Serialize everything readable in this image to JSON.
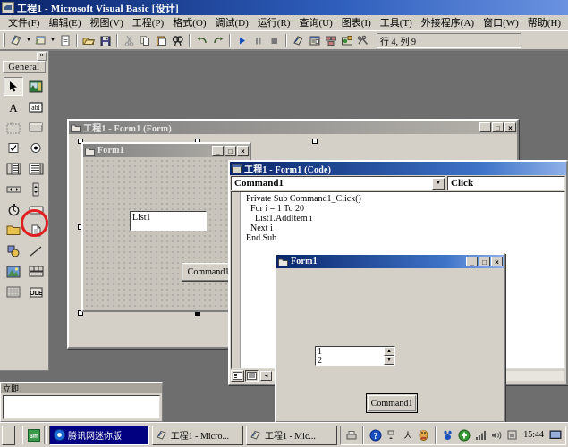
{
  "window": {
    "title": "工程1 - Microsoft Visual Basic [设计]",
    "icon": "vb-app-icon",
    "minimize": "_",
    "maximize": "□",
    "close": "×"
  },
  "menubar": {
    "items": [
      {
        "label": "文件(F)"
      },
      {
        "label": "编辑(E)"
      },
      {
        "label": "视图(V)"
      },
      {
        "label": "工程(P)"
      },
      {
        "label": "格式(O)"
      },
      {
        "label": "调试(D)"
      },
      {
        "label": "运行(R)"
      },
      {
        "label": "查询(U)"
      },
      {
        "label": "图表(I)"
      },
      {
        "label": "工具(T)"
      },
      {
        "label": "外接程序(A)"
      },
      {
        "label": "窗口(W)"
      },
      {
        "label": "帮助(H)"
      }
    ]
  },
  "toolbar": {
    "buttons": [
      {
        "name": "add-project-icon",
        "tip": "添加工程"
      },
      {
        "name": "add-form-icon",
        "tip": "添加窗体"
      },
      {
        "name": "menu-editor-icon",
        "tip": "菜单编辑器"
      },
      {
        "name": "open-project-icon",
        "tip": "打开工程"
      },
      {
        "name": "save-project-icon",
        "tip": "保存工程"
      },
      {
        "name": "cut-icon",
        "tip": "剪切"
      },
      {
        "name": "copy-icon",
        "tip": "复制"
      },
      {
        "name": "paste-icon",
        "tip": "粘贴"
      },
      {
        "name": "find-icon",
        "tip": "查找"
      },
      {
        "name": "undo-icon",
        "tip": "撤消"
      },
      {
        "name": "redo-icon",
        "tip": "重做"
      },
      {
        "name": "start-run-icon",
        "tip": "启动"
      },
      {
        "name": "pause-icon",
        "tip": "中断"
      },
      {
        "name": "stop-icon",
        "tip": "结束"
      },
      {
        "name": "project-explorer-icon",
        "tip": "工程资源管理器"
      },
      {
        "name": "properties-window-icon",
        "tip": "属性窗口"
      },
      {
        "name": "form-layout-icon",
        "tip": "窗体布局窗口"
      },
      {
        "name": "object-browser-icon",
        "tip": "对象浏览器"
      },
      {
        "name": "toolbox-icon",
        "tip": "工具箱"
      }
    ],
    "status_text": "行 4, 列 9"
  },
  "toolbox": {
    "tab_label": "General",
    "close_label": "×",
    "tools": [
      {
        "name": "pointer-tool",
        "selected": true
      },
      {
        "name": "picturebox-tool",
        "selected": false
      },
      {
        "name": "label-tool",
        "selected": false
      },
      {
        "name": "textbox-tool",
        "selected": false
      },
      {
        "name": "frame-tool",
        "selected": false
      },
      {
        "name": "commandbutton-tool",
        "selected": false
      },
      {
        "name": "checkbox-tool",
        "selected": false
      },
      {
        "name": "optionbutton-tool",
        "selected": false
      },
      {
        "name": "combobox-tool",
        "selected": false
      },
      {
        "name": "listbox-tool",
        "selected": false,
        "highlighted": true
      },
      {
        "name": "hscrollbar-tool",
        "selected": false
      },
      {
        "name": "vscrollbar-tool",
        "selected": false
      },
      {
        "name": "timer-tool",
        "selected": false
      },
      {
        "name": "drivelistbox-tool",
        "selected": false
      },
      {
        "name": "dirlistbox-tool",
        "selected": false
      },
      {
        "name": "filelistbox-tool",
        "selected": false
      },
      {
        "name": "shape-tool",
        "selected": false
      },
      {
        "name": "line-tool",
        "selected": false
      },
      {
        "name": "image-tool",
        "selected": false
      },
      {
        "name": "data-tool",
        "selected": false
      },
      {
        "name": "grid-tool",
        "selected": false
      },
      {
        "name": "ole-tool",
        "selected": false
      }
    ]
  },
  "form_designer": {
    "title": "工程1 - Form1 (Form)",
    "minimize": "_",
    "maximize": "□",
    "close": "×",
    "inner_form": {
      "title": "Form1",
      "minimize": "_",
      "maximize": "□",
      "close": "×",
      "listbox_label": "List1",
      "button_label": "Command1"
    }
  },
  "code_window": {
    "title": "工程1 - Form1 (Code)",
    "object_combo": "Command1",
    "procedure_combo": "Click",
    "dropdown_arrow": "▼",
    "code": "Private Sub Command1_Click()\n  For i = 1 To 20\n    List1.AddItem i\n  Next i\nEnd Sub",
    "view_procedure_name": "procedure-view-button",
    "view_module_name": "full-module-view-button",
    "hscroll_left": "◄"
  },
  "run_form": {
    "title": "Form1",
    "minimize": "_",
    "maximize": "□",
    "close": "×",
    "listbox_items": "1\n2",
    "scroll_up": "▲",
    "scroll_down": "▼",
    "button_label": "Command1"
  },
  "immediate_window": {
    "title": "立即",
    "content": ""
  },
  "taskbar": {
    "start_label": "",
    "quick_launch": [
      {
        "name": "msn-messenger-icon"
      }
    ],
    "tasks": [
      {
        "label": "腾讯网迷你版",
        "icon": "tencent-icon",
        "active": true
      },
      {
        "label": "工程1 - Micro...",
        "icon": "vb-app-icon",
        "active": false
      },
      {
        "label": "工程1 - Mic...",
        "icon": "vb-app-icon",
        "active": false
      }
    ],
    "tray": [
      {
        "name": "printer-icon"
      },
      {
        "name": "help-icon"
      },
      {
        "name": "network-icon"
      },
      {
        "name": "input-method-icon"
      },
      {
        "name": "qq-icon"
      },
      {
        "name": "baidu-icon"
      },
      {
        "name": "update-icon"
      },
      {
        "name": "signal-icon"
      },
      {
        "name": "volume-icon"
      },
      {
        "name": "security-icon"
      }
    ],
    "clock": "15:44",
    "show-desktop": "show-desktop-icon"
  },
  "colors": {
    "accent": "#0a246a",
    "face": "#d4d0c8",
    "desktop": "#6e6e6e",
    "highlight_ring": "#e02020"
  }
}
